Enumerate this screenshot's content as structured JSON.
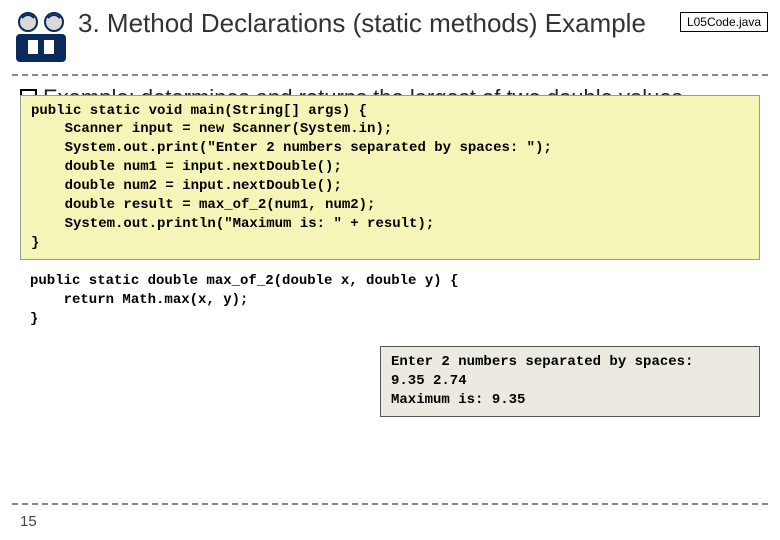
{
  "header": {
    "title": "3. Method Declarations (static methods) Example",
    "file_label": "L05Code.java"
  },
  "body": {
    "example_lead": "Example:",
    "example_rest": " determines and returns the largest of two double values"
  },
  "code": {
    "main": "public static void main(String[] args) {\n    Scanner input = new Scanner(System.in);\n    System.out.print(\"Enter 2 numbers separated by spaces: \");\n    double num1 = input.nextDouble();\n    double num2 = input.nextDouble();\n    double result = max_of_2(num1, num2);\n    System.out.println(\"Maximum is: \" + result);\n}",
    "method": "public static double max_of_2(double x, double y) {\n    return Math.max(x, y);\n}",
    "output": "Enter 2 numbers separated by spaces:\n9.35 2.74\nMaximum is: 9.35"
  },
  "footer": {
    "slide_number": "15"
  }
}
